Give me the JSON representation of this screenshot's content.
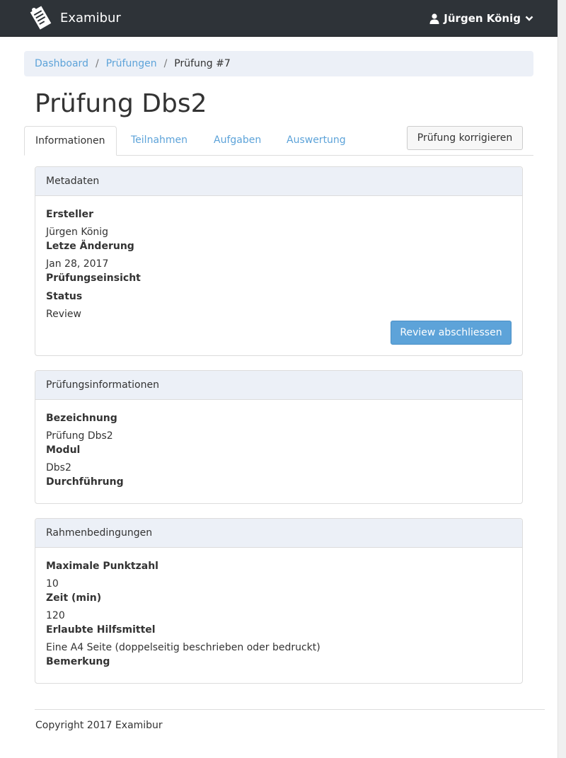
{
  "app": {
    "name": "Examibur"
  },
  "user": {
    "name": "Jürgen König"
  },
  "breadcrumb": [
    {
      "label": "Dashboard"
    },
    {
      "label": "Prüfungen"
    },
    {
      "label": "Prüfung #7"
    }
  ],
  "page": {
    "title": "Prüfung Dbs2"
  },
  "tabs": [
    {
      "label": "Informationen",
      "active": true
    },
    {
      "label": "Teilnahmen",
      "active": false
    },
    {
      "label": "Aufgaben",
      "active": false
    },
    {
      "label": "Auswertung",
      "active": false
    }
  ],
  "actions": {
    "correct_label": "Prüfung korrigieren"
  },
  "metadata": {
    "heading": "Metadaten",
    "creator_label": "Ersteller",
    "creator_value": "Jürgen König",
    "last_change_label": "Letze Änderung",
    "last_change_value": "Jan 28, 2017",
    "review_label": "Prüfungseinsicht",
    "status_label": "Status",
    "status_value": "Review",
    "finish_review_label": "Review abschliessen"
  },
  "exam_info": {
    "heading": "Prüfungsinformationen",
    "name_label": "Bezeichnung",
    "name_value": "Prüfung Dbs2",
    "module_label": "Modul",
    "module_value": "Dbs2",
    "execution_label": "Durchführung"
  },
  "conditions": {
    "heading": "Rahmenbedingungen",
    "max_points_label": "Maximale Punktzahl",
    "max_points_value": "10",
    "time_label": "Zeit (min)",
    "time_value": "120",
    "aids_label": "Erlaubte Hilfsmittel",
    "aids_value": "Eine A4 Seite (doppelseitig beschrieben oder bedruckt)",
    "remark_label": "Bemerkung"
  },
  "footer": {
    "copyright": "Copyright 2017 Examibur"
  },
  "colors": {
    "navbar": "#2e3338",
    "link": "#5da3d9",
    "panel_heading": "#ecf0f7",
    "primary": "#5da3d9"
  },
  "icons": {
    "brand": "exam-paper-icon",
    "user": "user-icon",
    "caret": "chevron-down-icon"
  }
}
